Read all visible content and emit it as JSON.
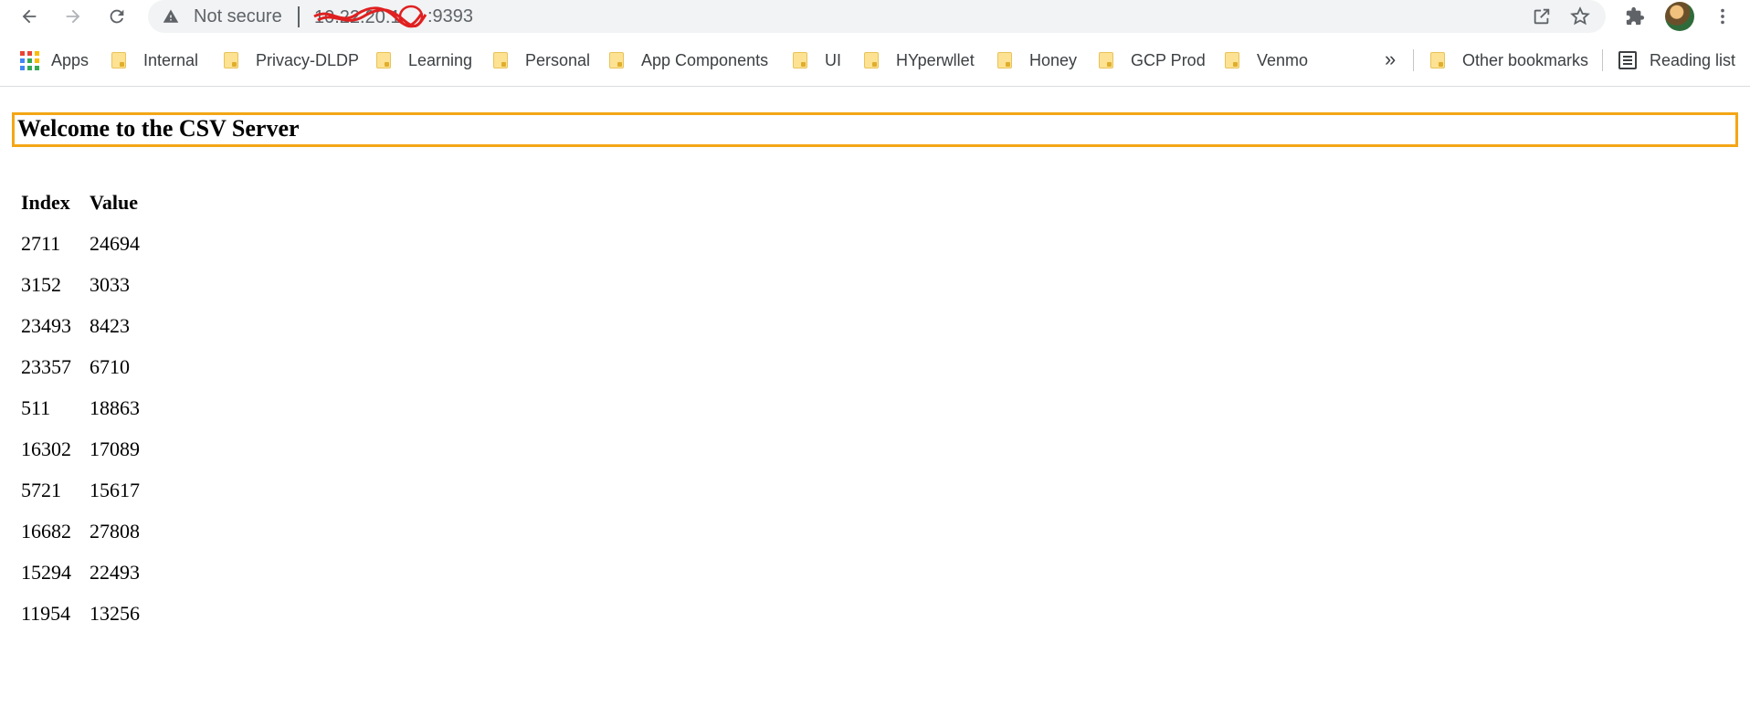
{
  "browser": {
    "security_label": "Not secure",
    "url_visible_suffix": ":9393",
    "icons": [
      "back-arrow-icon",
      "forward-arrow-icon",
      "reload-icon",
      "warning-icon",
      "share-icon",
      "star-icon",
      "extensions-icon",
      "kebab-menu-icon"
    ],
    "accent_color": "#f4a616"
  },
  "bookmarks": {
    "apps_label": "Apps",
    "items": [
      {
        "label": "Internal"
      },
      {
        "label": "Privacy-DLDP"
      },
      {
        "label": "Learning"
      },
      {
        "label": "Personal"
      },
      {
        "label": "App Components"
      },
      {
        "label": "UI"
      },
      {
        "label": "HYperwllet"
      },
      {
        "label": "Honey"
      },
      {
        "label": "GCP Prod"
      },
      {
        "label": "Venmo"
      }
    ],
    "more_label": "»",
    "other_label": "Other bookmarks",
    "reading_list_label": "Reading list"
  },
  "page": {
    "heading": "Welcome to the CSV Server",
    "table": {
      "headers": [
        "Index",
        "Value"
      ],
      "rows": [
        [
          "2711",
          "24694"
        ],
        [
          "3152",
          "3033"
        ],
        [
          "23493",
          "8423"
        ],
        [
          "23357",
          "6710"
        ],
        [
          "511",
          "18863"
        ],
        [
          "16302",
          "17089"
        ],
        [
          "5721",
          "15617"
        ],
        [
          "16682",
          "27808"
        ],
        [
          "15294",
          "22493"
        ],
        [
          "11954",
          "13256"
        ]
      ]
    }
  }
}
